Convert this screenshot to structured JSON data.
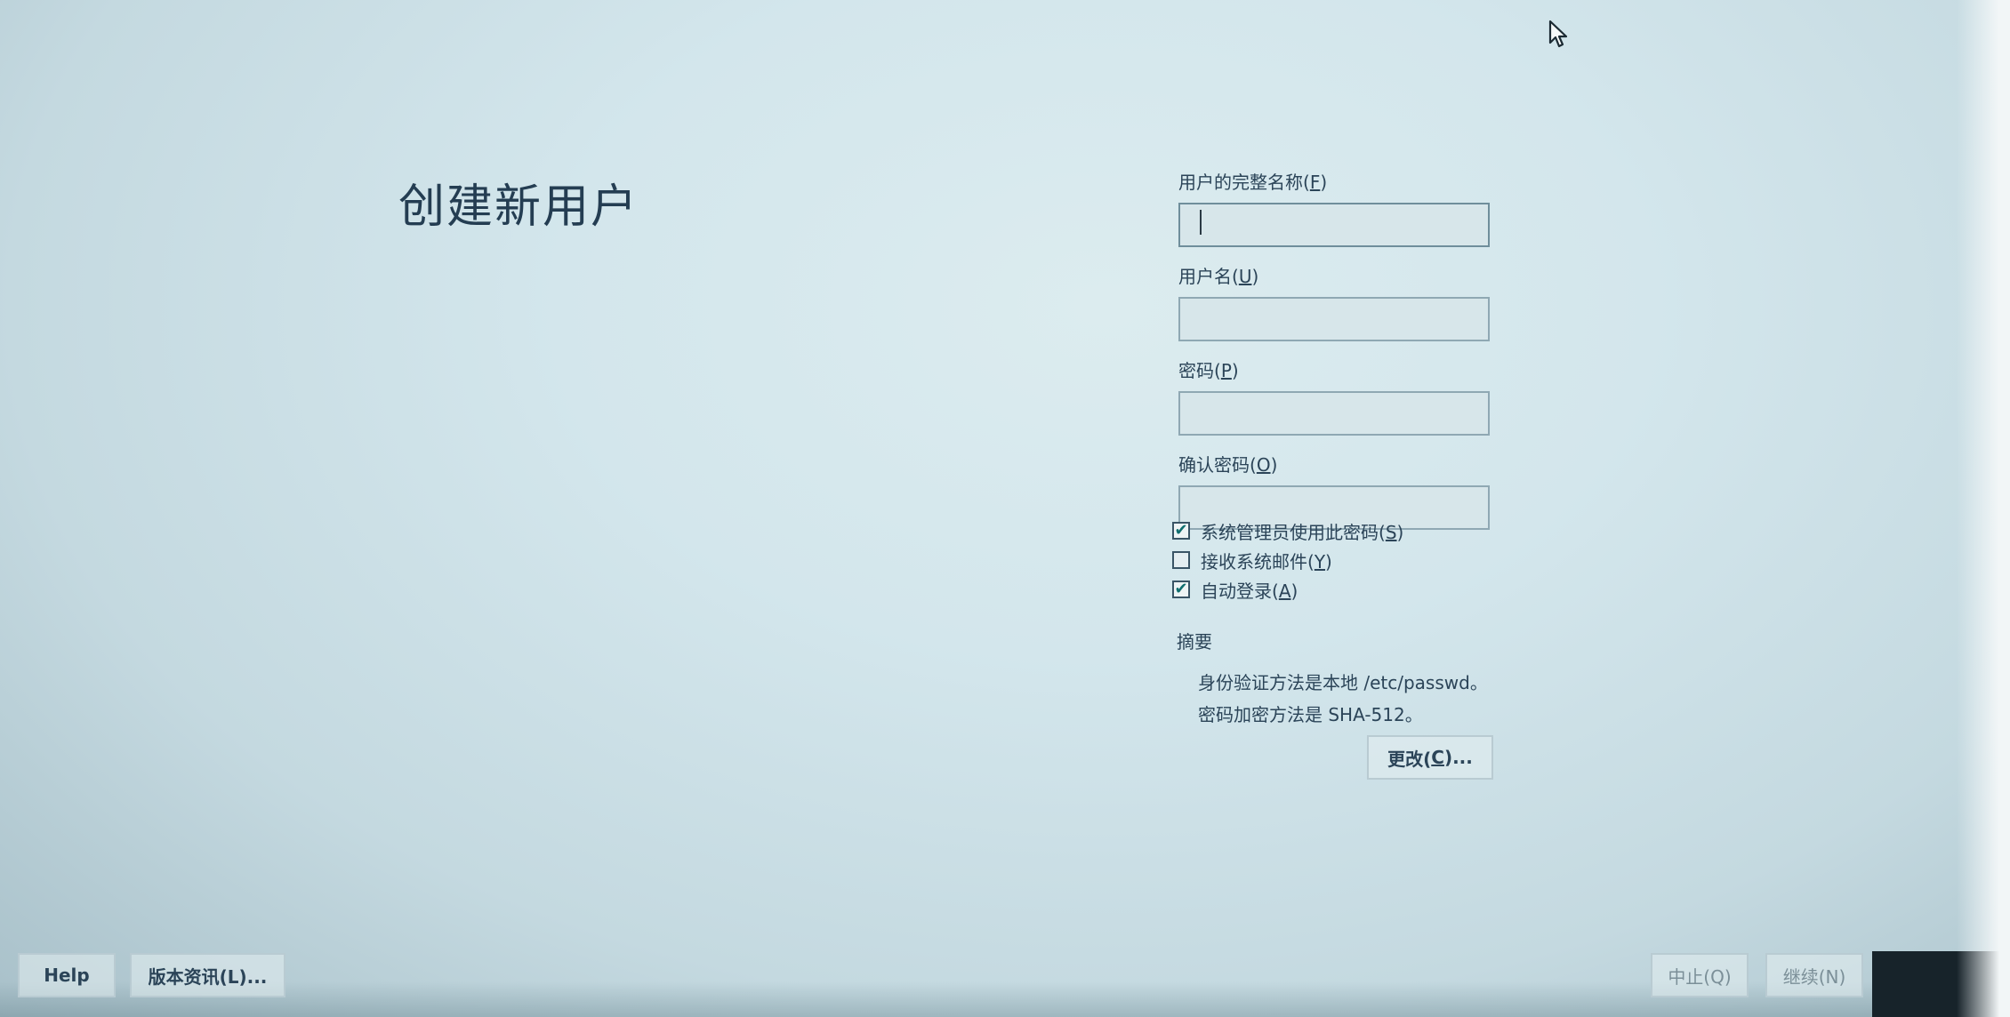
{
  "page": {
    "title": "创建新用户"
  },
  "form": {
    "full_name": {
      "label_text": "用户的完整名称(",
      "mnemonic": "F",
      "label_end": ")",
      "value": ""
    },
    "username": {
      "label_text": "用户名(",
      "mnemonic": "U",
      "label_end": ")",
      "value": ""
    },
    "password": {
      "label_text": "密码(",
      "mnemonic": "P",
      "label_end": ")",
      "value": ""
    },
    "confirm_password": {
      "label_text": "确认密码(",
      "mnemonic": "O",
      "label_end": ")",
      "value": ""
    }
  },
  "options": [
    {
      "label_text": "系统管理员使用此密码(",
      "mnemonic": "S",
      "label_end": ")",
      "checked": true
    },
    {
      "label_text": "接收系统邮件(",
      "mnemonic": "Y",
      "label_end": ")",
      "checked": false
    },
    {
      "label_text": "自动登录(",
      "mnemonic": "A",
      "label_end": ")",
      "checked": true
    }
  ],
  "summary": {
    "title": "摘要",
    "auth_line": "身份验证方法是本地 /etc/passwd。",
    "hash_line": "密码加密方法是 SHA-512。",
    "change_label_pre": "更改(",
    "change_mnemonic": "C",
    "change_label_post": ")..."
  },
  "footer": {
    "help_label": "Help",
    "about_label": "版本资讯(L)...",
    "quit_label": "中止(Q)",
    "next_label": "继续(N)"
  },
  "colors": {
    "check_mark": "#0f6e6e",
    "text": "#2b4458",
    "background": "#d3e6ec"
  },
  "icons": {
    "check": "✔",
    "pointer": "mouse-pointer-icon"
  }
}
